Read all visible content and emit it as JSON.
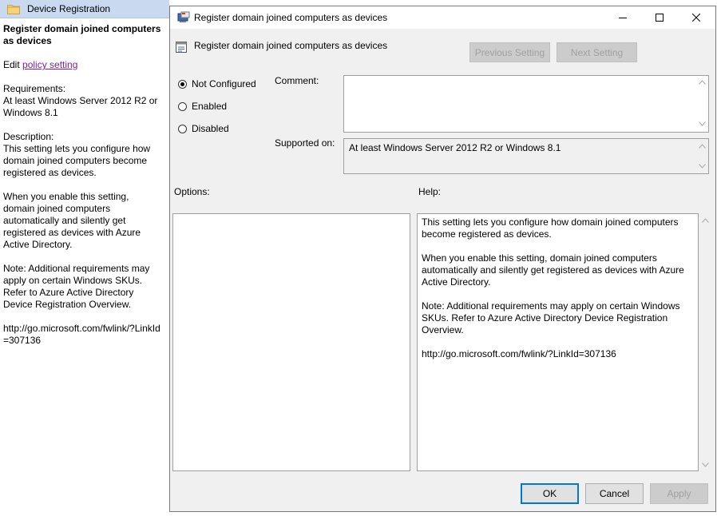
{
  "left_pane": {
    "header_title": "Device Registration",
    "title": "Register domain joined computers as devices",
    "edit_prefix": "Edit ",
    "edit_link": "policy setting ",
    "requirements_heading": "Requirements:",
    "requirements_text": "At least Windows Server 2012 R2 or Windows 8.1",
    "description_heading": "Description:",
    "description_p1": "This setting lets you configure how domain joined computers become registered as devices.",
    "description_p2": "When you enable this setting, domain joined computers automatically and silently get registered as devices with Azure Active Directory.",
    "description_p3": "Note: Additional requirements may apply on certain Windows SKUs. Refer to Azure Active Directory Device Registration Overview.",
    "link_url": "http://go.microsoft.com/fwlink/?LinkId=307136"
  },
  "dialog": {
    "title": "Register domain joined computers as devices",
    "header_title": "Register domain joined computers as devices",
    "previous_label": "Previous Setting",
    "next_label": "Next Setting",
    "radio_not_configured": "Not Configured",
    "radio_enabled": "Enabled",
    "radio_disabled": "Disabled",
    "selected_state": "Not Configured",
    "comment_label": "Comment:",
    "comment_value": "",
    "supported_label": "Supported on:",
    "supported_value": "At least Windows Server 2012 R2 or Windows 8.1",
    "options_label": "Options:",
    "help_label": "Help:",
    "help_p1": "This setting lets you configure how domain joined computers become registered as devices.",
    "help_p2": "When you enable this setting, domain joined computers automatically and silently get registered as devices with Azure Active Directory.",
    "help_p3": "Note: Additional requirements may apply on certain Windows SKUs. Refer to Azure Active Directory Device Registration Overview.",
    "help_p4": "http://go.microsoft.com/fwlink/?LinkId=307136",
    "ok_label": "OK",
    "cancel_label": "Cancel",
    "apply_label": "Apply"
  },
  "icons": {
    "folder": "folder-icon",
    "policy": "policy-icon",
    "minimize": "minimize-icon",
    "maximize": "maximize-icon",
    "close": "close-icon"
  },
  "colors": {
    "dialog_bg": "#f0f0f0",
    "left_header_bg": "#c9daf0",
    "link": "#7b1fa2",
    "focus_border": "#0078d7"
  }
}
